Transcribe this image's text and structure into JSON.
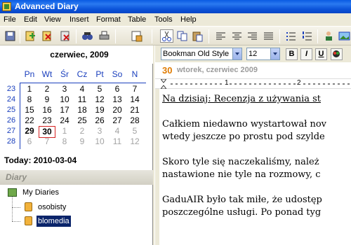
{
  "window": {
    "title": "Advanced Diary"
  },
  "menu": [
    "File",
    "Edit",
    "View",
    "Insert",
    "Format",
    "Table",
    "Tools",
    "Help"
  ],
  "calendar": {
    "month_label": "czerwiec, 2009",
    "weekday_headers": [
      "Pn",
      "Wt",
      "Śr",
      "Cz",
      "Pt",
      "So",
      "N"
    ],
    "weeks": [
      {
        "week": "23",
        "days": [
          "1",
          "2",
          "3",
          "4",
          "5",
          "6",
          "7"
        ]
      },
      {
        "week": "24",
        "days": [
          "8",
          "9",
          "10",
          "11",
          "12",
          "13",
          "14"
        ]
      },
      {
        "week": "25",
        "days": [
          "15",
          "16",
          "17",
          "18",
          "19",
          "20",
          "21"
        ]
      },
      {
        "week": "26",
        "days": [
          "22",
          "23",
          "24",
          "25",
          "26",
          "27",
          "28"
        ]
      },
      {
        "week": "27",
        "days": [
          "29",
          "30",
          "1",
          "2",
          "3",
          "4",
          "5"
        ]
      },
      {
        "week": "28",
        "days": [
          "6",
          "7",
          "8",
          "9",
          "10",
          "11",
          "12"
        ]
      }
    ],
    "today_label": "Today: 2010-03-04",
    "selected_day": "30"
  },
  "diary": {
    "header": "Diary",
    "root": "My Diaries",
    "items": [
      "osobisty",
      "blomedia"
    ],
    "selected_item": "blomedia"
  },
  "format": {
    "font_family": "Bookman Old Style",
    "font_size": "12",
    "bold": "B",
    "italic": "I",
    "underline": "U"
  },
  "entry": {
    "day_number": "30",
    "date_label": "wtorek, czerwiec 2009"
  },
  "ruler": {
    "labels": [
      "1",
      "2"
    ]
  },
  "document": {
    "lines": [
      "Na dzisiaj: Recenzja z używania st",
      "Całkiem niedawno wystartował nov",
      "wtedy jeszcze po prostu pod szylde",
      "Skoro tyle się naczekaliśmy, należ",
      "nastawione nie tyle na rozmowy, c",
      "GaduAIR było tak miłe, że udostęp",
      "poszczególne usługi. Po ponad tyg"
    ]
  },
  "colors": {
    "accent_blue": "#1a3fbd",
    "date_orange": "#e07b00",
    "selection": "#0a246a"
  }
}
